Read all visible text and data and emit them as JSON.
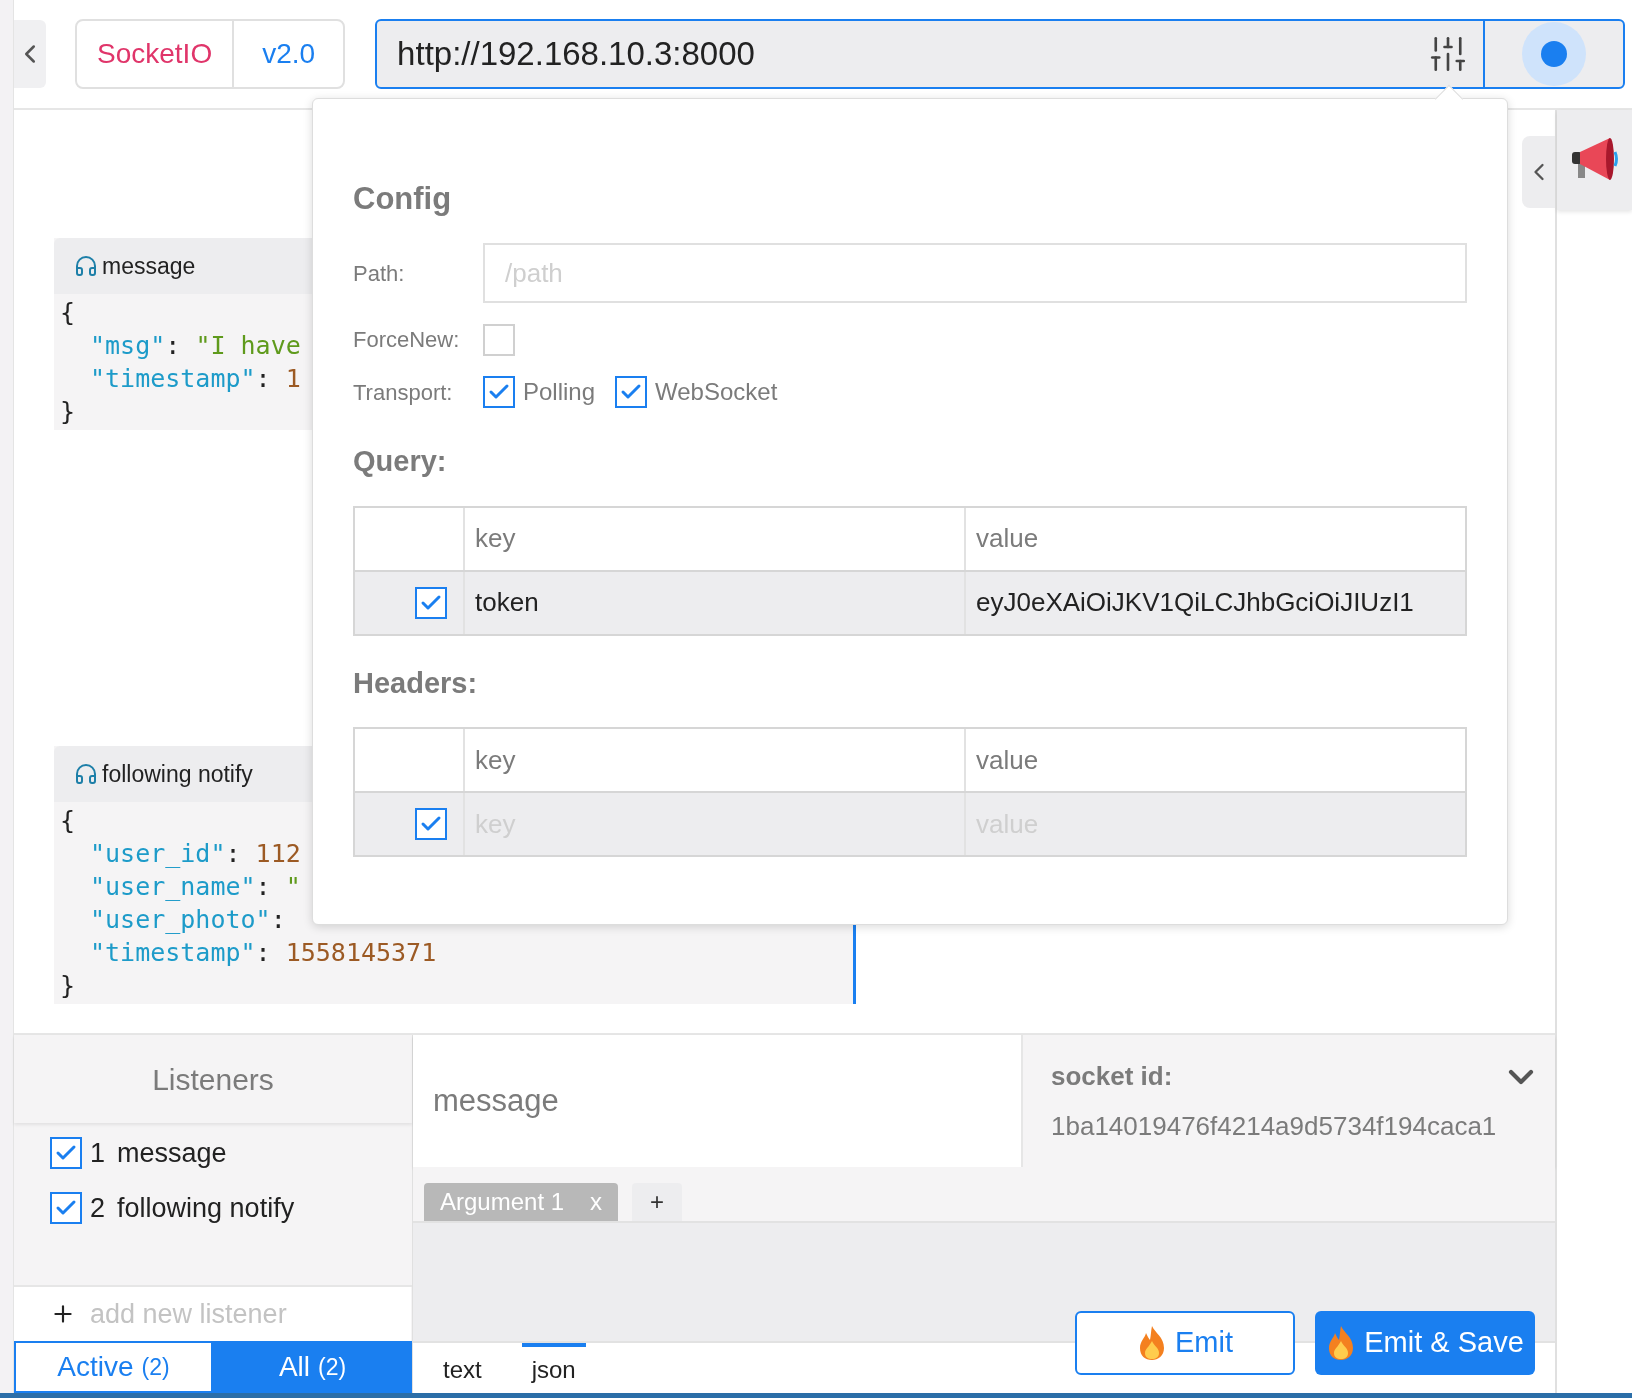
{
  "protocol": {
    "name": "SocketIO",
    "version": "v2.0"
  },
  "url": {
    "value": "http://192.168.10.3:8000",
    "connected": true
  },
  "log": [
    {
      "event": "message",
      "lines": [
        [
          {
            "kind": "punct",
            "text": "{"
          }
        ],
        [
          {
            "kind": "key",
            "text": "\"msg\""
          },
          {
            "kind": "punct",
            "text": ": "
          },
          {
            "kind": "string",
            "text": "\"I have"
          }
        ],
        [
          {
            "kind": "key",
            "text": "\"timestamp\""
          },
          {
            "kind": "punct",
            "text": ": "
          },
          {
            "kind": "number",
            "text": "1"
          }
        ],
        [
          {
            "kind": "punct",
            "text": "}"
          }
        ]
      ]
    },
    {
      "event": "following notify",
      "lines": [
        [
          {
            "kind": "punct",
            "text": "{"
          }
        ],
        [
          {
            "kind": "key",
            "text": "\"user_id\""
          },
          {
            "kind": "punct",
            "text": ": "
          },
          {
            "kind": "number",
            "text": "112"
          }
        ],
        [
          {
            "kind": "key",
            "text": "\"user_name\""
          },
          {
            "kind": "punct",
            "text": ": "
          },
          {
            "kind": "string",
            "text": "\""
          }
        ],
        [
          {
            "kind": "key",
            "text": "\"user_photo\""
          },
          {
            "kind": "punct",
            "text": ":"
          }
        ],
        [
          {
            "kind": "key",
            "text": "\"timestamp\""
          },
          {
            "kind": "punct",
            "text": ": "
          },
          {
            "kind": "number",
            "text": "1558145371"
          }
        ],
        [
          {
            "kind": "punct",
            "text": "}"
          }
        ]
      ]
    }
  ],
  "config": {
    "title": "Config",
    "path": {
      "label": "Path:",
      "placeholder": "/path"
    },
    "force_new": {
      "label": "ForceNew:",
      "checked": false
    },
    "transport": {
      "label": "Transport:",
      "options": [
        {
          "label": "Polling",
          "checked": true
        },
        {
          "label": "WebSocket",
          "checked": true
        }
      ]
    }
  },
  "query": {
    "title": "Query:",
    "columns": [
      "key",
      "value"
    ],
    "rows": [
      {
        "checked": true,
        "key": "token",
        "value": "eyJ0eXAiOiJKV1QiLCJhbGciOiJIUzI1"
      }
    ]
  },
  "headers": {
    "title": "Headers:",
    "columns": [
      "key",
      "value"
    ],
    "rows": [
      {
        "checked": true,
        "key_placeholder": "key",
        "value_placeholder": "value"
      }
    ]
  },
  "listeners": {
    "title": "Listeners",
    "items": [
      {
        "index": "1",
        "name": "message",
        "checked": true
      },
      {
        "index": "2",
        "name": "following notify",
        "checked": true
      }
    ],
    "add": {
      "placeholder": "add new listener"
    },
    "filters": [
      {
        "label": "Active",
        "count": "(2)",
        "selected": false
      },
      {
        "label": "All",
        "count": "(2)",
        "selected": true
      }
    ]
  },
  "emitter": {
    "event": {
      "placeholder": "message"
    },
    "socket_id": {
      "label": "socket id:",
      "value": "1ba14019476f4214a9d5734f194caca1"
    },
    "arguments": [
      {
        "label": "Argument 1",
        "close": "x",
        "selected": true
      }
    ],
    "add_argument": "+",
    "formats": [
      {
        "label": "text",
        "selected": false
      },
      {
        "label": "json",
        "selected": true
      }
    ],
    "buttons": [
      {
        "label": "Emit",
        "kind": "outline"
      },
      {
        "label": "Emit & Save",
        "kind": "primary"
      }
    ]
  }
}
